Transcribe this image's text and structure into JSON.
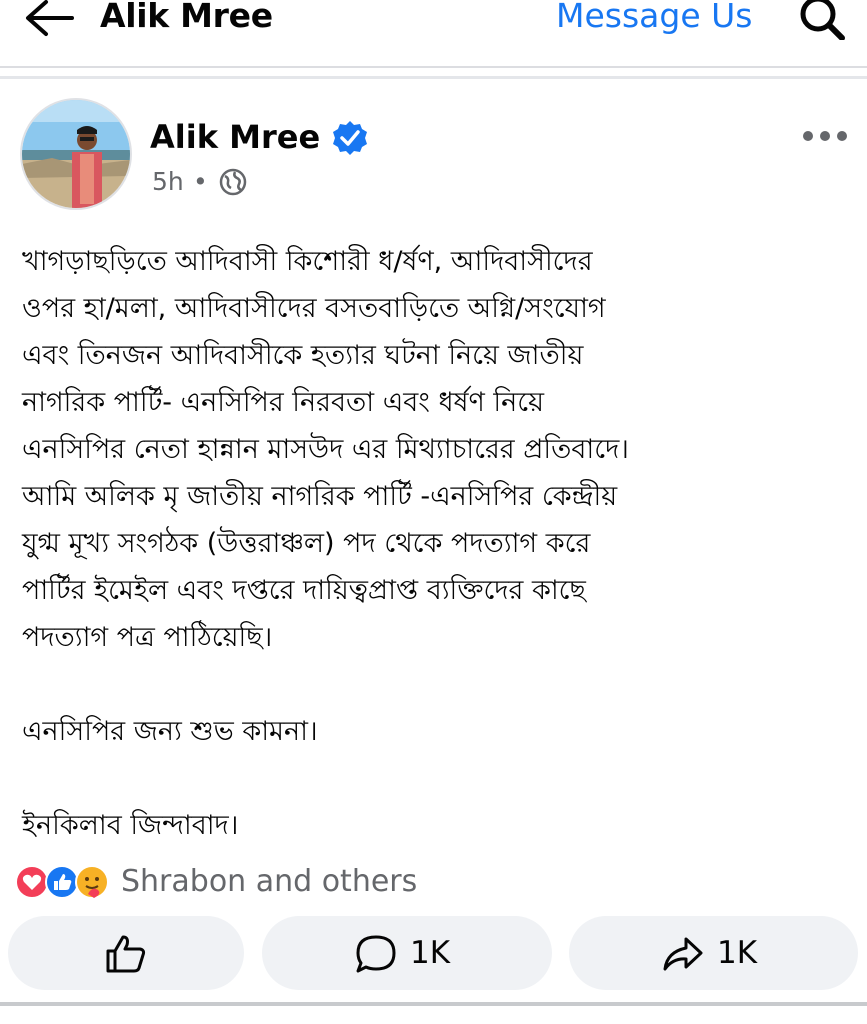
{
  "header": {
    "page_name": "Alik Mree",
    "message_link": "Message Us"
  },
  "post": {
    "author": "Alik Mree",
    "time": "5h",
    "dot": "•",
    "paragraphs": [
      "খাগড়াছড়িতে আদিবাসী কিশোরী ধ/র্ষণ, আদিবাসীদের",
      "ওপর হা/মলা, আদিবাসীদের বসতবাড়িতে অগ্নি/সংযোগ",
      "এবং তিনজন আদিবাসীকে হত্যার ঘটনা নিয়ে জাতীয়",
      "নাগরিক পার্টি- এনসিপির নিরবতা এবং ধর্ষণ নিয়ে",
      "এনসিপির নেতা হান্নান মাসউদ এর মিথ্যাচারের প্রতিবাদে।",
      "আমি অলিক মৃ জাতীয় নাগরিক পার্টি -এনসিপির কেন্দ্রীয়",
      "যুগ্ম মূখ্য সংগঠক (উত্তরাঞ্চল) পদ থেকে পদত্যাগ করে",
      "পার্টির ইমেইল এবং দপ্তরে দায়িত্বপ্রাপ্ত ব্যক্তিদের কাছে",
      "পদত্যাগ পত্র পাঠিয়েছি।"
    ],
    "wish": "এনসিপির জন্য শুভ কামনা।",
    "slogan": "ইনকিলাব জিন্দাবাদ।",
    "reactions_text": "Shrabon and others",
    "comment_count": "1K",
    "share_count": "1K"
  },
  "colors": {
    "accent": "#1877f2",
    "secondary_text": "#65676b",
    "button_bg": "#f0f2f5"
  },
  "icons": [
    "back-arrow-icon",
    "search-icon",
    "verified-badge-icon",
    "globe-icon",
    "more-icon",
    "love-reaction-icon",
    "like-reaction-icon",
    "care-reaction-icon",
    "like-icon",
    "comment-icon",
    "share-icon"
  ]
}
